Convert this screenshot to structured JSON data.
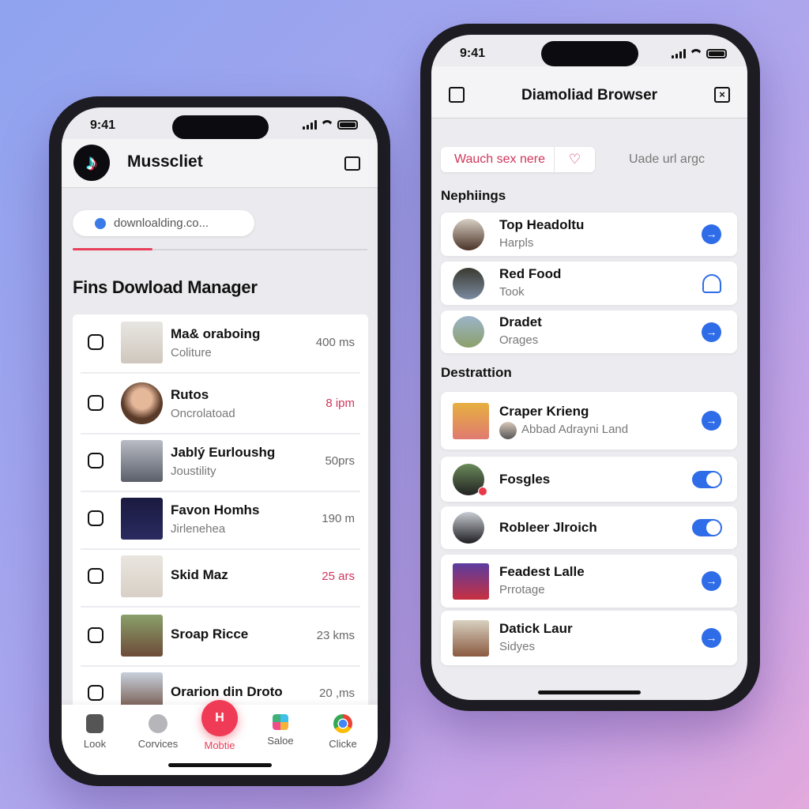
{
  "left_phone": {
    "status": {
      "time": "9:41"
    },
    "header": {
      "app_name": "Musscliet",
      "logo_icon": "tiktok-logo-icon",
      "action_icon": "shopping-bag-icon"
    },
    "search": {
      "value": "downloalding.co...",
      "icon": "globe-icon"
    },
    "progress": {
      "percent": 27,
      "color": "#e8405a"
    },
    "section_title": "Fins Dowload Manager",
    "downloads": [
      {
        "title": "Ma& oraboing",
        "subtitle": "Coliture",
        "meta": "400 ms",
        "meta_color": "#666",
        "shape": "square"
      },
      {
        "title": "Rutos",
        "subtitle": "Oncrolatoad",
        "meta": "8 ipm",
        "meta_color": "#d0355a",
        "shape": "circle"
      },
      {
        "title": "Jablý Eurloushg",
        "subtitle": "Joustility",
        "meta": "50prs",
        "meta_color": "#666",
        "shape": "square"
      },
      {
        "title": "Favon Homhs",
        "subtitle": "Jirlenehea",
        "meta": "190 m",
        "meta_color": "#666",
        "shape": "square"
      },
      {
        "title": "Skid Maz",
        "subtitle": "",
        "meta": "25 ars",
        "meta_color": "#d0355a",
        "shape": "square"
      },
      {
        "title": "Sroap Ricce",
        "subtitle": "",
        "meta": "23 kms",
        "meta_color": "#666",
        "shape": "square"
      },
      {
        "title": "Orarion din Droto",
        "subtitle": "",
        "meta": "20 ,ms",
        "meta_color": "#666",
        "shape": "square"
      }
    ],
    "bottom_nav": [
      {
        "label": "Look",
        "icon": "profile-icon"
      },
      {
        "label": "Corvices",
        "icon": "chat-icon"
      },
      {
        "label": "Mobtie",
        "icon": "download-fab-icon",
        "active": true
      },
      {
        "label": "Saloe",
        "icon": "apps-grid-icon"
      },
      {
        "label": "Clicke",
        "icon": "chrome-icon"
      }
    ]
  },
  "right_phone": {
    "status": {
      "time": "9:41"
    },
    "header": {
      "title": "Diamoliad Browser",
      "left_icon": "folder-icon",
      "right_icon": "close-bag-icon"
    },
    "search": {
      "value": "Wauch sex nere",
      "heart_icon": "heart-icon",
      "secondary_text": "Uade url argc"
    },
    "sections": [
      {
        "title": "Nephiings",
        "items": [
          {
            "title": "Top Headoltu",
            "subtitle": "Harpls",
            "action": "arrow"
          },
          {
            "title": "Red Food",
            "subtitle": "Took",
            "action": "cloud"
          },
          {
            "title": "Dradet",
            "subtitle": "Orages",
            "action": "arrow"
          }
        ]
      },
      {
        "title": "Destrattion",
        "items": [
          {
            "title": "Craper Krieng",
            "subtitle": "Abbad Adrayni Land",
            "action": "arrow"
          },
          {
            "title": "Fosgles",
            "subtitle": "",
            "action": "toggle",
            "toggle_on": true
          },
          {
            "title": "Robleer Jlroich",
            "subtitle": "",
            "action": "toggle",
            "toggle_on": true
          },
          {
            "title": "Feadest Lalle",
            "subtitle": "Prrotage",
            "action": "arrow"
          },
          {
            "title": "Datick Laur",
            "subtitle": "Sidyes",
            "action": "arrow"
          }
        ]
      }
    ],
    "accent_color": "#2f6ce8"
  }
}
